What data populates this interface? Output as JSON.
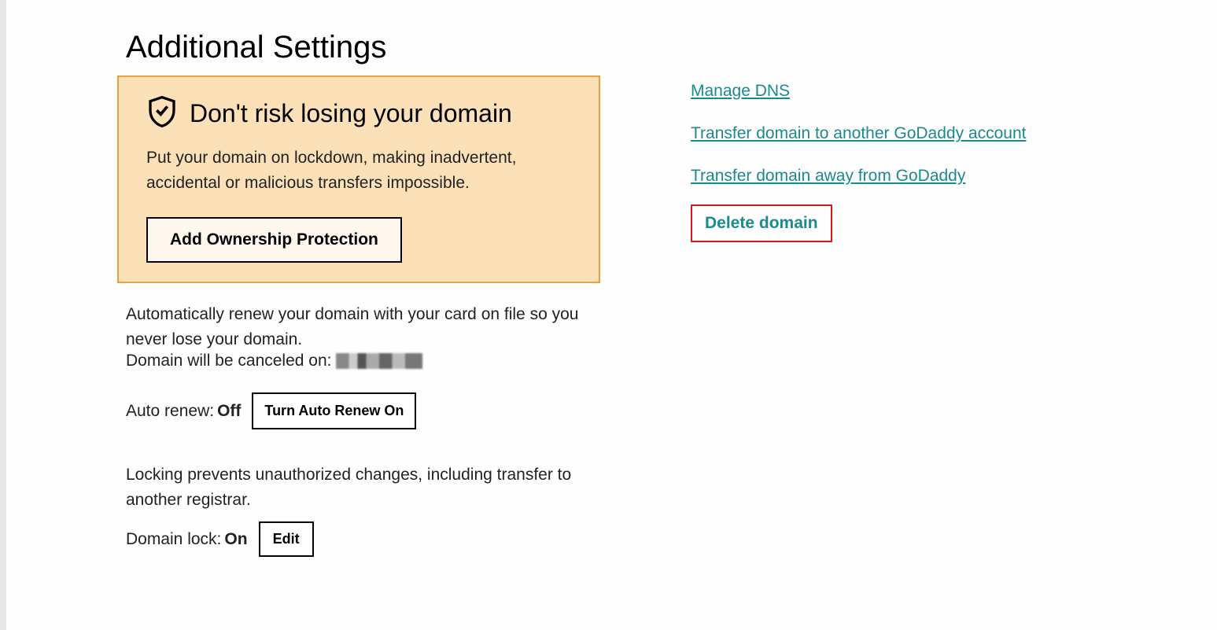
{
  "page": {
    "title": "Additional Settings"
  },
  "protection": {
    "title": "Don't risk losing your domain",
    "description": "Put your domain on lockdown, making inadvertent, accidental or malicious transfers impossible.",
    "button": "Add Ownership Protection"
  },
  "renew": {
    "description": "Automatically renew your domain with your card on file so you never lose your domain.",
    "cancel_prefix": "Domain will be canceled on:",
    "label": "Auto renew:",
    "status": "Off",
    "button": "Turn Auto Renew On"
  },
  "lock": {
    "description": "Locking prevents unauthorized changes, including transfer to another registrar.",
    "label": "Domain lock:",
    "status": "On",
    "button": "Edit"
  },
  "links": {
    "manage_dns": "Manage DNS",
    "transfer_account": "Transfer domain to another GoDaddy account",
    "transfer_away": "Transfer domain away from GoDaddy",
    "delete": "Delete domain"
  }
}
